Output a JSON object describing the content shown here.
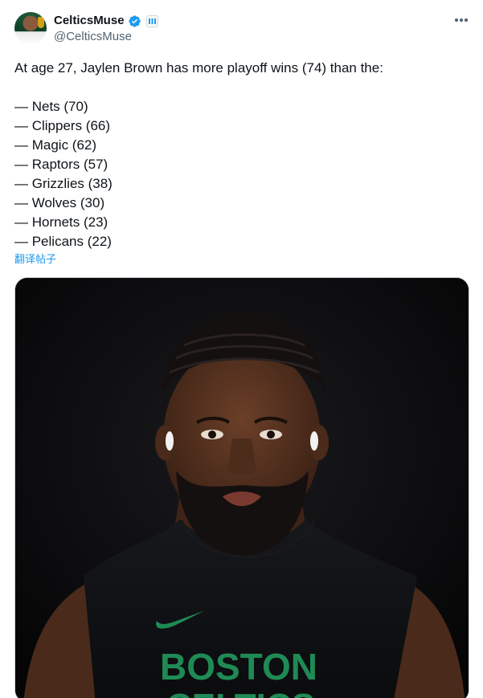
{
  "author": {
    "display_name": "CelticsMuse",
    "handle": "@CelticsMuse",
    "avatar_icon": "avatar-photo",
    "verified_icon": "verified-badge-icon",
    "verified_color": "#1d9bf0"
  },
  "post": {
    "intro": "At age 27, Jaylen Brown has more playoff wins (74) than the:",
    "items": [
      "— Nets (70)",
      "— Clippers (66)",
      "— Magic (62)",
      "— Raptors (57)",
      "— Grizzlies (38)",
      "— Wolves (30)",
      "— Hornets (23)",
      "— Pelicans (22)"
    ],
    "translate_label": "翻译帖子"
  },
  "media": {
    "jersey_text_line1": "BOSTON",
    "jersey_text_line2": "CELTICS",
    "jersey_text_color": "#1f8a55",
    "logo_icon": "nike-swoosh-icon"
  },
  "menu": {
    "more_icon": "more-options-icon"
  }
}
